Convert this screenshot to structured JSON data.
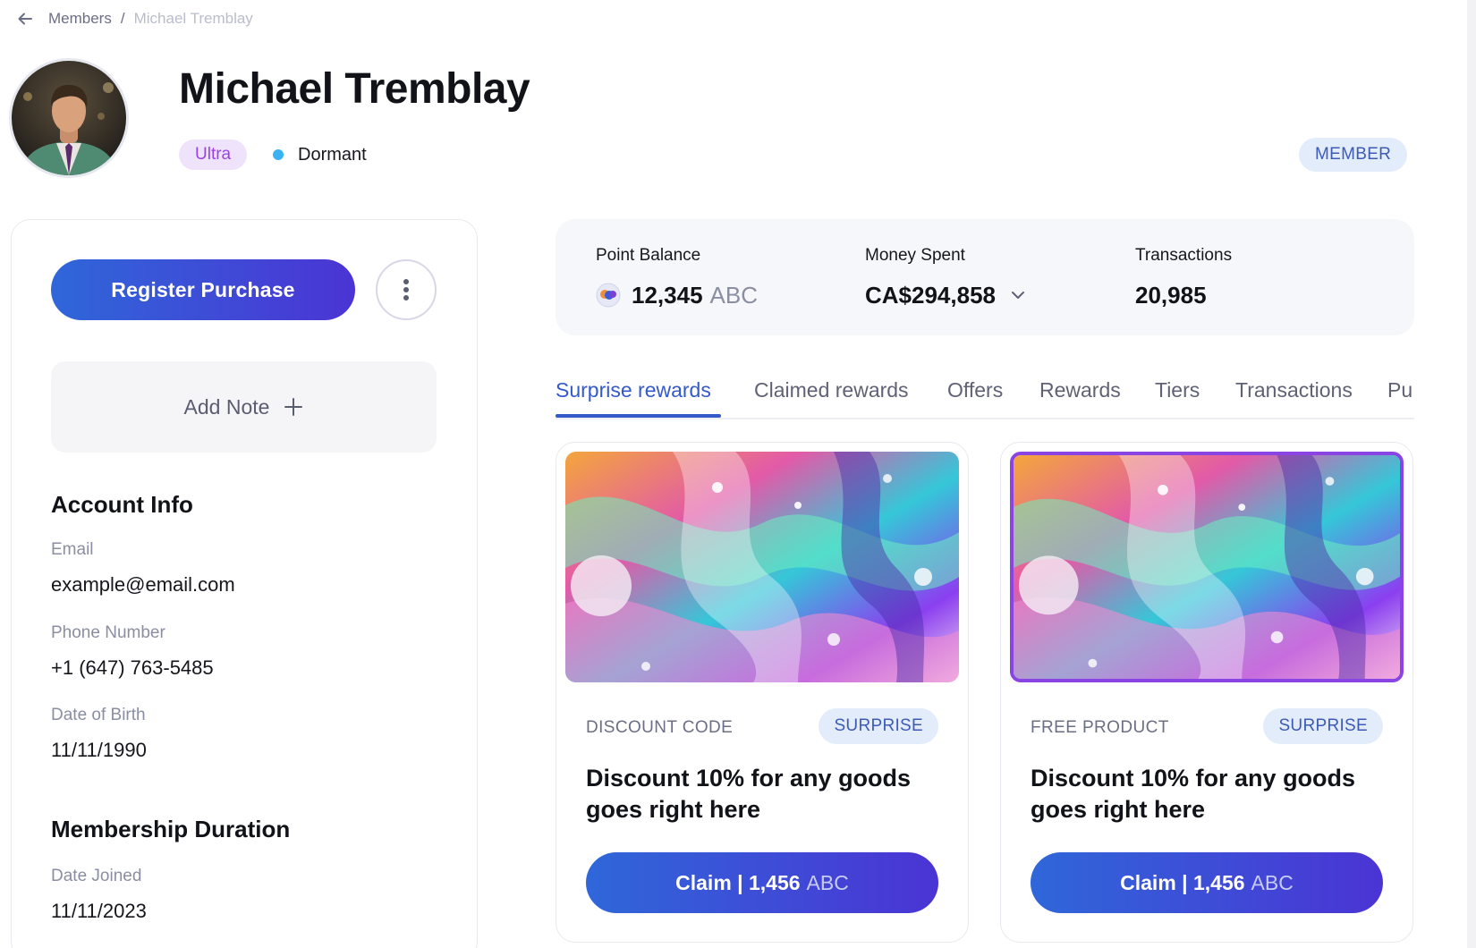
{
  "breadcrumb": {
    "parent": "Members",
    "separator": "/",
    "current": "Michael Tremblay"
  },
  "member": {
    "name": "Michael Tremblay",
    "tier": "Ultra",
    "status": "Dormant",
    "role": "MEMBER"
  },
  "actions": {
    "register_purchase": "Register Purchase",
    "add_note": "Add Note"
  },
  "account_info": {
    "title": "Account Info",
    "email_label": "Email",
    "email": "example@email.com",
    "phone_label": "Phone Number",
    "phone": "+1 (647) 763-5485",
    "dob_label": "Date of Birth",
    "dob": "11/11/1990"
  },
  "membership": {
    "title": "Membership Duration",
    "joined_label": "Date Joined",
    "joined": "11/11/2023"
  },
  "stats": {
    "points_label": "Point Balance",
    "points": "12,345",
    "points_unit": "ABC",
    "money_label": "Money Spent",
    "money": "CA$294,858",
    "transactions_label": "Transactions",
    "transactions": "20,985"
  },
  "tabs": [
    {
      "label": "Surprise rewards",
      "active": true
    },
    {
      "label": "Claimed rewards",
      "active": false
    },
    {
      "label": "Offers",
      "active": false
    },
    {
      "label": "Rewards",
      "active": false
    },
    {
      "label": "Tiers",
      "active": false
    },
    {
      "label": "Transactions",
      "active": false
    },
    {
      "label": "Pu",
      "active": false
    }
  ],
  "rewards": [
    {
      "type": "DISCOUNT CODE",
      "tag": "SURPRISE",
      "title": "Discount 10% for any goods goes right here",
      "claim_label": "Claim | 1,456",
      "claim_unit": "ABC",
      "selected": false
    },
    {
      "type": "FREE PRODUCT",
      "tag": "SURPRISE",
      "title": "Discount 10% for any goods goes right here",
      "claim_label": "Claim | 1,456",
      "claim_unit": "ABC",
      "selected": true
    }
  ],
  "colors": {
    "accent": "#3459c9",
    "button_gradient_start": "#2f67d9",
    "button_gradient_end": "#4b34d4",
    "tier_badge_bg": "#efe3fb",
    "tier_badge_text": "#9b42e6",
    "status_dot": "#3bb3f3",
    "selected_border": "#8a44e4"
  },
  "icons": {
    "back": "arrow-left-icon",
    "more": "kebab-icon",
    "add": "plus-icon",
    "coin": "coin-icon",
    "expand": "chevron-down-icon"
  }
}
